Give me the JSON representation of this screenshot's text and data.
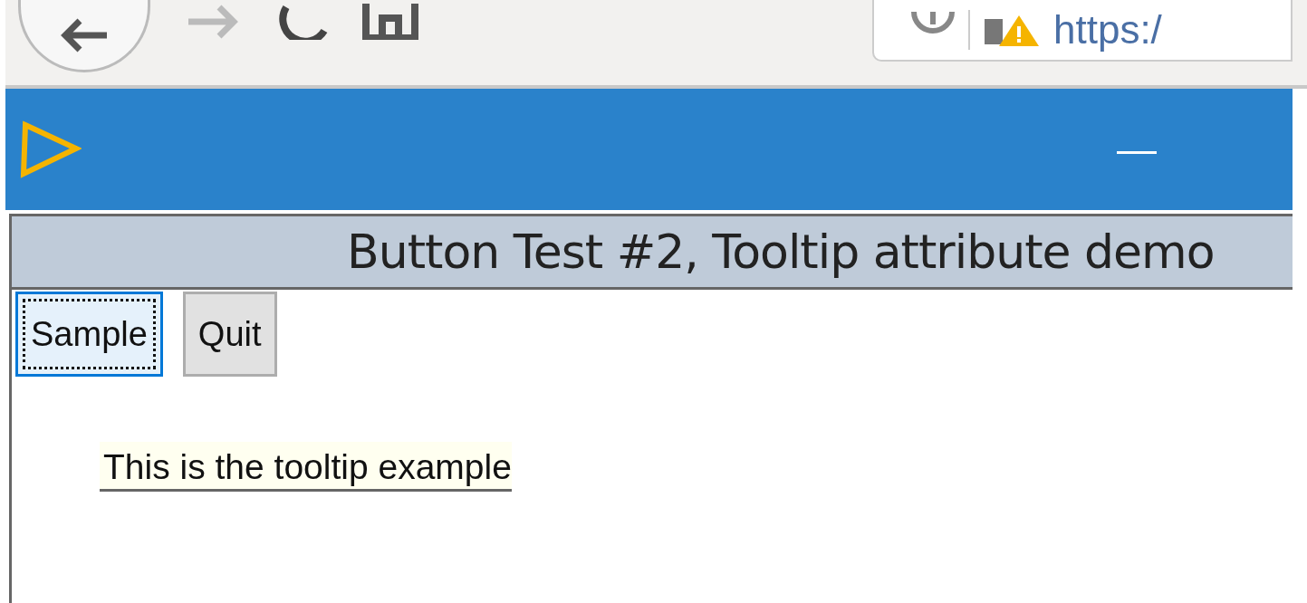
{
  "browser": {
    "address": "https:/"
  },
  "app_bar": {
    "minimize": "—"
  },
  "panel": {
    "title": "Button Test #2, Tooltip attribute demo"
  },
  "buttons": [
    {
      "label": "Sample",
      "focused": true
    },
    {
      "label": "Quit",
      "focused": false
    }
  ],
  "tooltip": {
    "text": "This is the tooltip example"
  }
}
